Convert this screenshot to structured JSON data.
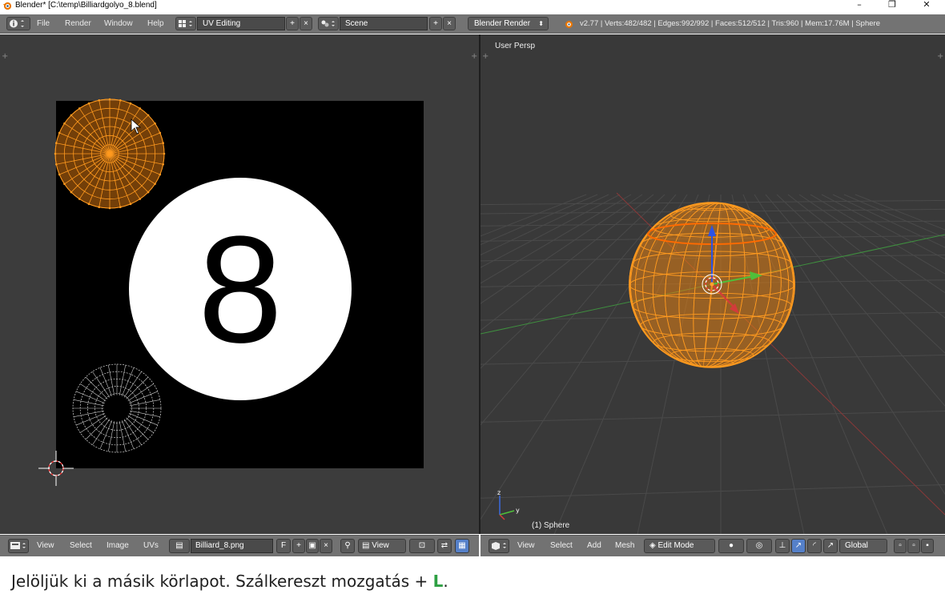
{
  "window": {
    "title": "Blender* [C:\\temp\\Billiardgolyo_8.blend]",
    "controls": [
      "–",
      "❐",
      "✕"
    ]
  },
  "header": {
    "menus": [
      "File",
      "Render",
      "Window",
      "Help"
    ],
    "screen_layout": "UV Editing",
    "scene": "Scene",
    "render_engine": "Blender Render",
    "stats": "v2.77 | Verts:482/482 | Edges:992/992 | Faces:512/512 | Tris:960 | Mem:17.76M | Sphere"
  },
  "uv_editor": {
    "image_label": "8",
    "footer": {
      "menus": [
        "View",
        "Select",
        "Image",
        "UVs"
      ],
      "image_name": "Billiard_8.png",
      "fake_user": "F",
      "view_mode": "View"
    }
  },
  "view3d": {
    "view_label": "User Persp",
    "object_label": "(1) Sphere",
    "axis_labels": [
      "y",
      "z"
    ],
    "footer": {
      "menus": [
        "View",
        "Select",
        "Add",
        "Mesh"
      ],
      "mode": "Edit Mode",
      "orientation": "Global"
    }
  },
  "caption": {
    "text": "Jelöljük ki a másik körlapot. Szálkereszt mozgatás + ",
    "key": "L",
    "end": "."
  },
  "colors": {
    "accent_orange": "#ff9a1f",
    "axis_x": "#d23b3b",
    "axis_y": "#4fbf3a",
    "axis_z": "#2c53e6",
    "caption_key": "#2ea043"
  }
}
